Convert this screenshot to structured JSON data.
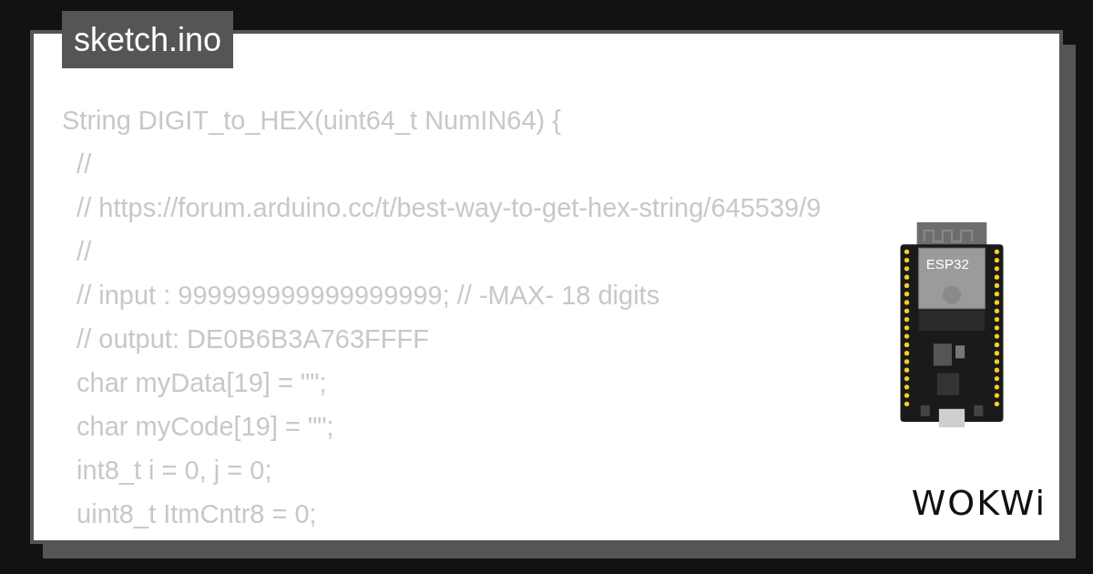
{
  "file_tab": {
    "title": "sketch.ino"
  },
  "code_lines": [
    "String DIGIT_to_HEX(uint64_t NumIN64) {",
    "  //",
    "  // https://forum.arduino.cc/t/best-way-to-get-hex-string/645539/9",
    "  //",
    "  // input : 999999999999999999; // -MAX- 18 digits",
    "  // output: DE0B6B3A763FFFF",
    "  char myData[19] = \"\";",
    "  char myCode[19] = \"\";",
    "  int8_t i = 0, j = 0;",
    "  uint8_t ItmCntr8 = 0;"
  ],
  "board": {
    "chip_label": "ESP32"
  },
  "logo": {
    "text": "WOKWi"
  }
}
